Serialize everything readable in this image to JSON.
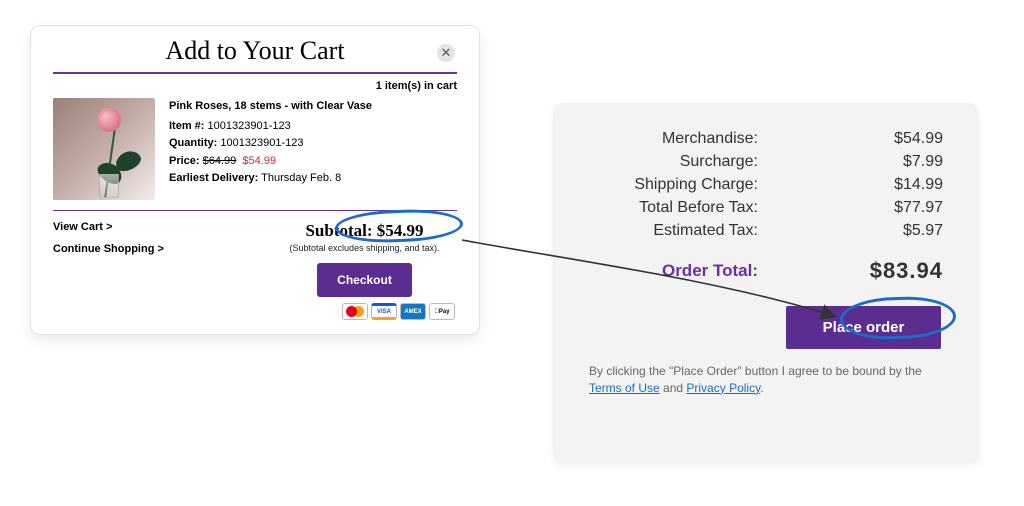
{
  "cart": {
    "title": "Add to Your Cart",
    "items_count_text": "1 item(s) in cart",
    "item": {
      "name": "Pink Roses, 18 stems - with Clear Vase",
      "item_no_label": "Item #:",
      "item_no": "1001323901-123",
      "qty_label": "Quantity:",
      "qty": "1001323901-123",
      "price_label": "Price:",
      "price_orig": "$64.99",
      "price_sale": "$54.99",
      "delivery_label": "Earliest Delivery:",
      "delivery_value": "Thursday Feb. 8"
    },
    "links": {
      "view_cart": "View Cart >",
      "continue": "Continue Shopping >"
    },
    "subtotal_label": "Subtotal:",
    "subtotal_value": "$54.99",
    "subtotal_note": "(Subtotal excludes shipping, and tax).",
    "checkout_label": "Checkout",
    "pay_icons": {
      "visa": "VISA",
      "amex": "AMEX",
      "apay": "Pay"
    }
  },
  "summary": {
    "rows": {
      "merch_k": "Merchandise:",
      "merch_v": "$54.99",
      "sur_k": "Surcharge:",
      "sur_v": "$7.99",
      "ship_k": "Shipping Charge:",
      "ship_v": "$14.99",
      "tbt_k": "Total Before Tax:",
      "tbt_v": "$77.97",
      "tax_k": "Estimated Tax:",
      "tax_v": "$5.97"
    },
    "total_k": "Order Total:",
    "total_v": "$83.94",
    "place_order": "Place order",
    "legal_pre": "By clicking the \"Place Order\" button I agree to be bound by the ",
    "terms": "Terms of Use",
    "legal_mid": " and ",
    "privacy": "Privacy Policy",
    "legal_end": "."
  },
  "chart_data": {
    "type": "table",
    "title": "Order cost breakdown",
    "rows": [
      {
        "label": "Merchandise",
        "value": 54.99
      },
      {
        "label": "Surcharge",
        "value": 7.99
      },
      {
        "label": "Shipping Charge",
        "value": 14.99
      },
      {
        "label": "Total Before Tax",
        "value": 77.97
      },
      {
        "label": "Estimated Tax",
        "value": 5.97
      },
      {
        "label": "Order Total",
        "value": 83.94
      }
    ]
  }
}
